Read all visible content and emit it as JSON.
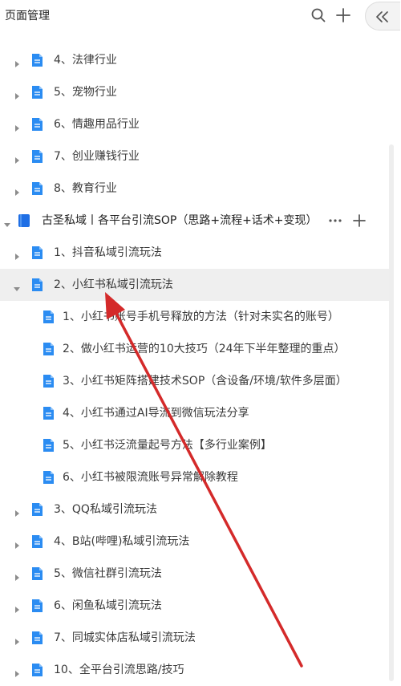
{
  "header": {
    "title": "页面管理",
    "icons": [
      "search-icon",
      "plus-icon",
      "double-chevron-left-icon"
    ]
  },
  "tree": {
    "rows": [
      {
        "label": "4、法律行业",
        "level": 1,
        "icon": "doc-icon",
        "arrow": "right"
      },
      {
        "label": "5、宠物行业",
        "level": 1,
        "icon": "doc-icon",
        "arrow": "right"
      },
      {
        "label": "6、情趣用品行业",
        "level": 1,
        "icon": "doc-icon",
        "arrow": "right"
      },
      {
        "label": "7、创业赚钱行业",
        "level": 1,
        "icon": "doc-icon",
        "arrow": "right"
      },
      {
        "label": "8、教育行业",
        "level": 1,
        "icon": "doc-icon",
        "arrow": "right"
      },
      {
        "label": "古圣私域丨各平台引流SOP（思路+流程+话术+变现）",
        "level": 0,
        "icon": "book-icon",
        "arrow": "down",
        "actions": [
          "more-icon",
          "plus-icon"
        ]
      },
      {
        "label": "1、抖音私域引流玩法",
        "level": 1,
        "icon": "doc-icon",
        "arrow": "right"
      },
      {
        "label": "2、小红书私域引流玩法",
        "level": 1,
        "icon": "doc-icon",
        "arrow": "down",
        "selected": true
      },
      {
        "label": "1、小红书账号手机号释放的方法（针对未实名的账号）",
        "level": 2,
        "icon": "doc-icon"
      },
      {
        "label": "2、做小红书运营的10大技巧（24年下半年整理的重点）",
        "level": 2,
        "icon": "doc-icon"
      },
      {
        "label": "3、小红书矩阵搭建技术SOP（含设备/环境/软件多层面）",
        "level": 2,
        "icon": "doc-icon"
      },
      {
        "label": "4、小红书通过AI导流到微信玩法分享",
        "level": 2,
        "icon": "doc-icon"
      },
      {
        "label": "5、小红书泛流量起号方法【多行业案例】",
        "level": 2,
        "icon": "doc-icon"
      },
      {
        "label": "6、小红书被限流账号异常解除教程",
        "level": 2,
        "icon": "doc-icon"
      },
      {
        "label": "3、QQ私域引流玩法",
        "level": 1,
        "icon": "doc-icon",
        "arrow": "right"
      },
      {
        "label": "4、B站(哔哩)私域引流玩法",
        "level": 1,
        "icon": "doc-icon",
        "arrow": "right"
      },
      {
        "label": "5、微信社群引流玩法",
        "level": 1,
        "icon": "doc-icon",
        "arrow": "right"
      },
      {
        "label": "6、闲鱼私域引流玩法",
        "level": 1,
        "icon": "doc-icon",
        "arrow": "right"
      },
      {
        "label": "7、同城实体店私域引流玩法",
        "level": 1,
        "icon": "doc-icon",
        "arrow": "right"
      },
      {
        "label": "10、全平台引流思路/技巧",
        "level": 1,
        "icon": "doc-icon",
        "arrow": "right"
      }
    ]
  },
  "colors": {
    "doc_icon": "#2b8cf2",
    "book_icon": "#1f6fe5",
    "selected_row": "#efefef",
    "arrow_annotation": "#d42a2a",
    "text": "#3a3a3a",
    "muted_icon": "#8c8c8c"
  }
}
